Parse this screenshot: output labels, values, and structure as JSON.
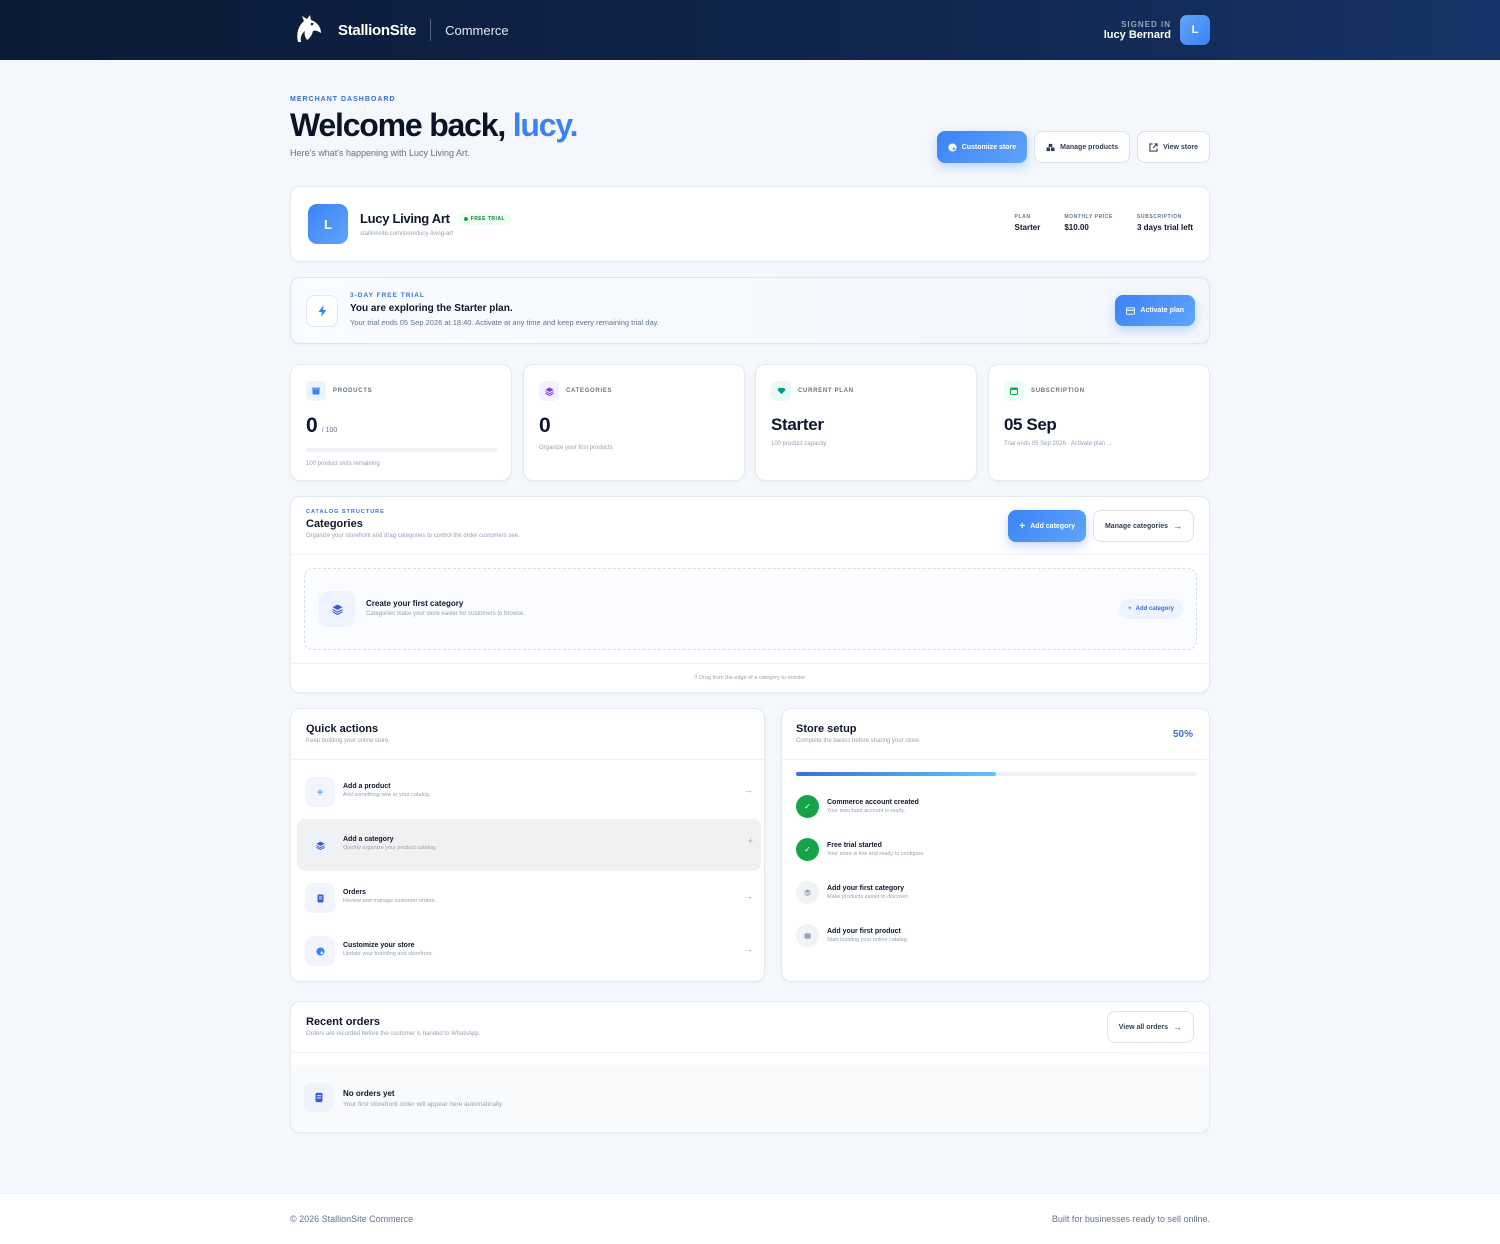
{
  "header": {
    "brand_name": "StallionSite",
    "app_name": "Commerce",
    "signed_in_label": "SIGNED IN",
    "user_name": "lucy Bernard",
    "user_initial": "L"
  },
  "hero": {
    "kicker": "MERCHANT DASHBOARD",
    "title_prefix": "Welcome back,",
    "title_name": "lucy.",
    "subtitle": "Here's what's happening with Lucy Living Art.",
    "actions": {
      "customize": "Customize store",
      "manage_products": "Manage products",
      "view_store": "View store"
    }
  },
  "store": {
    "initial": "L",
    "name": "Lucy Living Art",
    "badge": "FREE TRIAL",
    "url": "stallionsite.com/store/lucy-living-art",
    "meta": [
      {
        "label": "PLAN",
        "value": "Starter"
      },
      {
        "label": "MONTHLY PRICE",
        "value": "$10.00"
      },
      {
        "label": "SUBSCRIPTION",
        "value": "3 days trial left"
      }
    ]
  },
  "trial": {
    "kicker": "3-DAY FREE TRIAL",
    "title": "You are exploring the Starter plan.",
    "text": "Your trial ends 05 Sep 2026 at 18:40. Activate at any time and keep every remaining trial day.",
    "button": "Activate plan"
  },
  "stats": {
    "products": {
      "label": "PRODUCTS",
      "value": "0",
      "suffix": "/ 100",
      "note": "100 product slots remaining",
      "progress": 0
    },
    "categories": {
      "label": "CATEGORIES",
      "value": "0",
      "note": "Organize your first products"
    },
    "plan": {
      "label": "CURRENT PLAN",
      "value": "Starter",
      "note": "100 product capacity"
    },
    "subscription": {
      "label": "SUBSCRIPTION",
      "value": "05 Sep",
      "note": "Trial ends 05 Sep 2026 · Activate plan →"
    }
  },
  "categories": {
    "kicker": "CATALOG STRUCTURE",
    "title": "Categories",
    "subtitle": "Organize your storefront and drag categories to control the order customers see.",
    "add_button": "Add category",
    "manage_button": "Manage categories",
    "empty_title": "Create your first category",
    "empty_sub": "Categories make your store easier for customers to browse.",
    "empty_button": "Add category",
    "drag_hint": "Drag from the edge of a category to reorder."
  },
  "quick_actions": {
    "title": "Quick actions",
    "subtitle": "Keep building your online store.",
    "items": [
      {
        "title": "Add a product",
        "sub": "Add something new to your catalog.",
        "icon": "plus-icon"
      },
      {
        "title": "Add a category",
        "sub": "Quickly organize your product catalog.",
        "icon": "layers-icon"
      },
      {
        "title": "Orders",
        "sub": "Review and manage customer orders.",
        "icon": "receipt-icon"
      },
      {
        "title": "Customize your store",
        "sub": "Update your branding and storefront.",
        "icon": "palette-icon"
      }
    ]
  },
  "setup": {
    "title": "Store setup",
    "subtitle": "Complete the basics before sharing your store.",
    "percent_label": "50%",
    "progress": 0.5,
    "steps": [
      {
        "title": "Commerce account created",
        "sub": "Your merchant account is ready.",
        "done": true
      },
      {
        "title": "Free trial started",
        "sub": "Your store is live and ready to configure.",
        "done": true
      },
      {
        "title": "Add your first category",
        "sub": "Make products easier to discover.",
        "done": false
      },
      {
        "title": "Add your first product",
        "sub": "Start building your online catalog.",
        "done": false
      }
    ]
  },
  "orders": {
    "title": "Recent orders",
    "subtitle": "Orders are recorded before the customer is handed to WhatsApp.",
    "button": "View all orders",
    "empty_title": "No orders yet",
    "empty_sub": "Your first storefront order will appear here automatically."
  },
  "footer": {
    "left": "© 2026 StallionSite Commerce",
    "right": "Built for businesses ready to sell online."
  },
  "colors": {
    "accent": "#3b82f6",
    "navy": "#0b1a36",
    "success": "#16a34a"
  }
}
